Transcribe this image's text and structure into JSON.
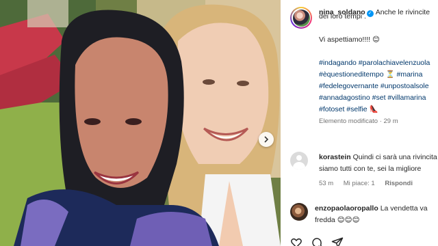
{
  "post": {
    "username": "nina_soldano",
    "caption_line1": "Anche le rivincite",
    "caption_line2": "dei loro tempi .",
    "caption_line3": "Vi aspettiamo!!!! 😊",
    "hashtags_line1": "#indagando #parolachiavelenzuola",
    "hashtags_line2": "#èquestioneditempo ⏳ #marina",
    "hashtags_line3": "#fedelegovernante #unpostoalsole",
    "hashtags_line4": "#annadagostino #set #villamarina",
    "hashtags_line5": "#fotoset #selfie 👠",
    "edited_label": "Elemento modificato",
    "edited_time": "· 29 m"
  },
  "comments": [
    {
      "user": "korastein",
      "text_line1": "Quindi ci sarà una rivincita",
      "text_line2": "siamo tutti con te, sei la migliore",
      "time": "53 m",
      "likes": "Mi piace: 1",
      "reply": "Rispondi",
      "avatar": "default-avatar-icon"
    },
    {
      "user": "enzopaolaoropallo",
      "text_line1": "La vendetta va",
      "text_line2": "fredda 😊😊😊",
      "avatar": "user-photo"
    }
  ],
  "colors": {
    "hashtag": "#00376b",
    "verified": "#0095f6",
    "meta": "#737373"
  },
  "icons": {
    "like": "heart-icon",
    "comment": "comment-icon",
    "share": "paper-plane-icon",
    "next": "chevron-right-icon",
    "verified": "verified-badge-icon"
  }
}
